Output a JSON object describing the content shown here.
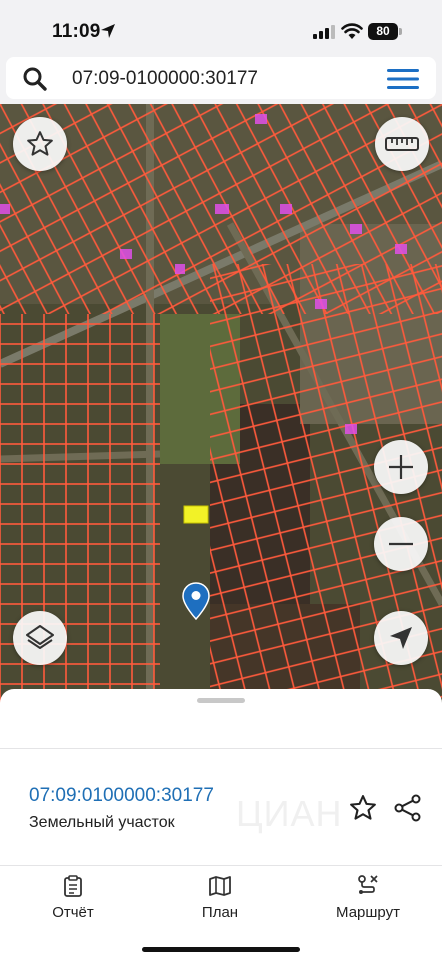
{
  "status_bar": {
    "time": "11:09",
    "battery": "80"
  },
  "search": {
    "query": "07:09-0100000:30177"
  },
  "map": {
    "parcel_line_color": "#ff5a3c",
    "selected_parcel_color": "#f2f227",
    "marker_color": "#1e6fc0"
  },
  "card": {
    "cadastral_number": "07:09:0100000:30177",
    "object_type": "Земельный участок",
    "watermark": "ЦИАН",
    "accent_color": "#1f6fb5"
  },
  "tabs": [
    {
      "label": "Отчёт",
      "icon": "report-icon"
    },
    {
      "label": "План",
      "icon": "map-plan-icon"
    },
    {
      "label": "Маршрут",
      "icon": "route-icon"
    }
  ]
}
